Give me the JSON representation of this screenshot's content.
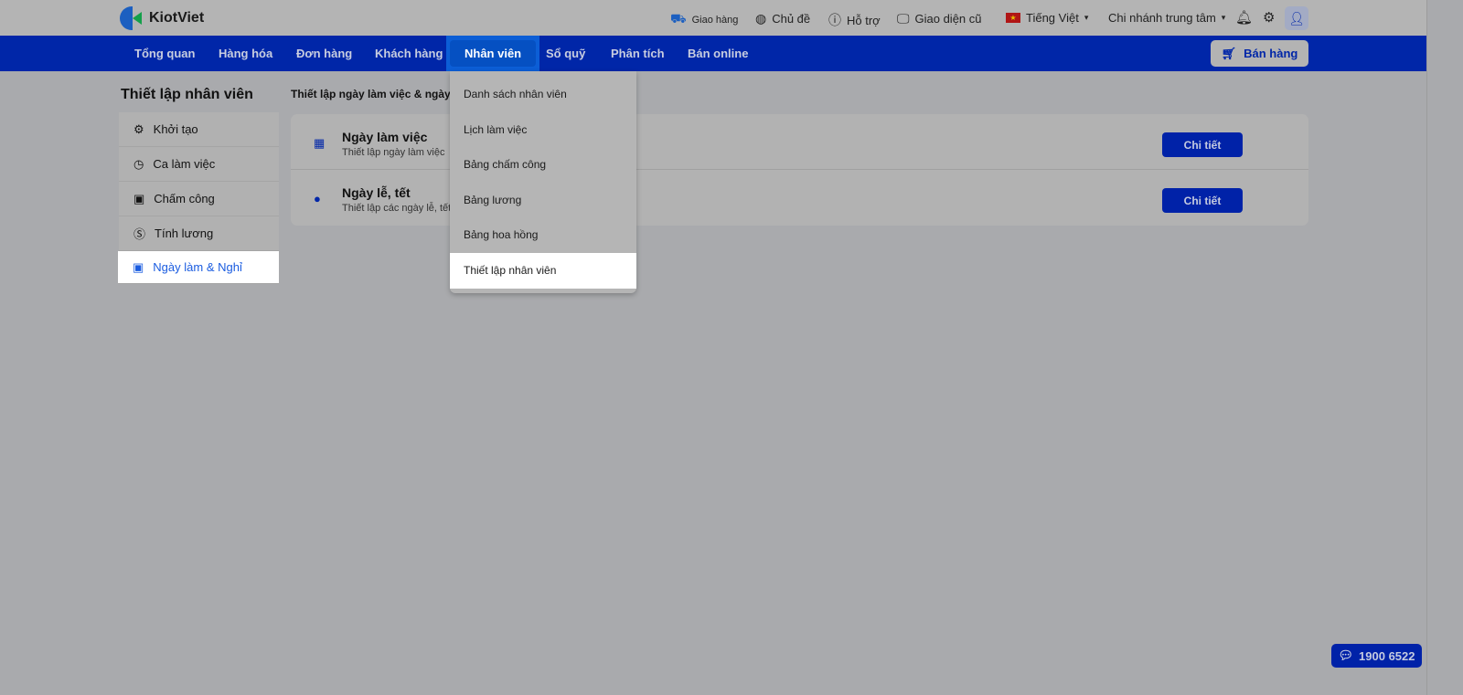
{
  "brand": "KiotViet",
  "topbar": {
    "delivery": "Giao hàng",
    "theme": "Chủ đề",
    "support": "Hỗ trợ",
    "old_ui": "Giao diện cũ",
    "language": "Tiếng Việt",
    "branch": "Chi nhánh trung tâm"
  },
  "nav": {
    "items": [
      "Tổng quan",
      "Hàng hóa",
      "Đơn hàng",
      "Khách hàng",
      "Nhân viên",
      "Sổ quỹ",
      "Phân tích",
      "Bán online"
    ],
    "sell": "Bán hàng"
  },
  "sidebar": {
    "title": "Thiết lập nhân viên",
    "items": [
      "Khởi tạo",
      "Ca làm việc",
      "Chấm công",
      "Tính lương",
      "Ngày làm & Nghỉ"
    ]
  },
  "content": {
    "header": "Thiết lập ngày làm việc & ngày",
    "rows": [
      {
        "title": "Ngày làm việc",
        "desc": "Thiết lập ngày làm việc",
        "button": "Chi tiết"
      },
      {
        "title": "Ngày lễ, tết",
        "desc": "Thiết lập các ngày lễ, tết",
        "button": "Chi tiết"
      }
    ]
  },
  "dropdown": [
    "Danh sách nhân viên",
    "Lịch làm việc",
    "Bảng chấm công",
    "Bảng lương",
    "Bảng hoa hồng",
    "Thiết lập nhân viên"
  ],
  "hotline": "1900 6522",
  "colors": {
    "primary": "#0026a8",
    "active": "#1a5ce0"
  }
}
